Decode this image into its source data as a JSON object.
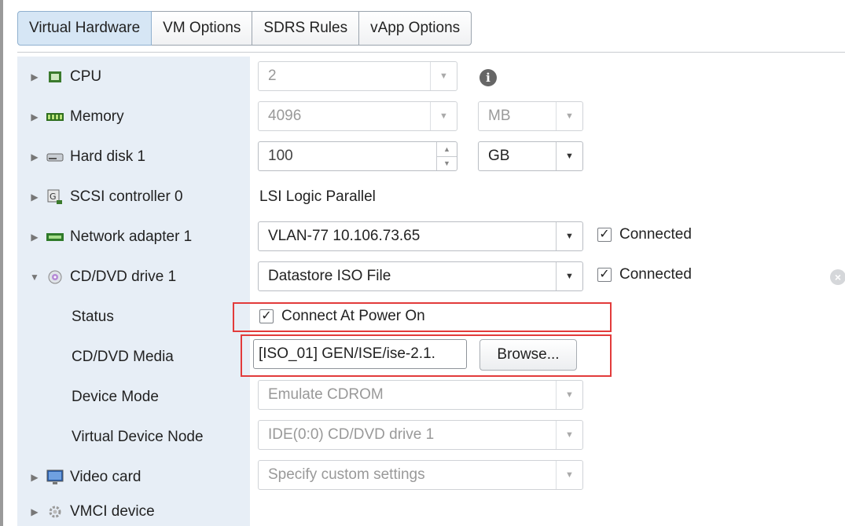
{
  "tabs": [
    {
      "label": "Virtual Hardware",
      "active": true
    },
    {
      "label": "VM Options"
    },
    {
      "label": "SDRS Rules"
    },
    {
      "label": "vApp Options"
    }
  ],
  "hardware": {
    "cpu": {
      "label": "CPU",
      "icon": "cpu-icon",
      "value": "2"
    },
    "memory": {
      "label": "Memory",
      "icon": "memory-icon",
      "value": "4096",
      "unit": "MB"
    },
    "hard_disk": {
      "label": "Hard disk 1",
      "icon": "hard-disk-icon",
      "value": "100",
      "unit": "GB"
    },
    "scsi": {
      "label": "SCSI controller 0",
      "icon": "scsi-controller-icon",
      "value": "LSI Logic Parallel"
    },
    "network": {
      "label": "Network adapter 1",
      "icon": "network-adapter-icon",
      "value": "VLAN-77 10.106.73.65",
      "connected_label": "Connected",
      "connected": true
    },
    "cddvd": {
      "label": "CD/DVD drive 1",
      "icon": "cd-dvd-icon",
      "value": "Datastore ISO File",
      "connected_label": "Connected",
      "connected": true,
      "status": {
        "label": "Status",
        "option_label": "Connect At Power On",
        "checked": true
      },
      "media": {
        "label": "CD/DVD Media",
        "value": "[ISO_01] GEN/ISE/ise-2.1.",
        "browse_label": "Browse..."
      },
      "device_mode": {
        "label": "Device Mode",
        "value": "Emulate CDROM"
      },
      "device_node": {
        "label": "Virtual Device Node",
        "value": "IDE(0:0) CD/DVD drive 1"
      }
    },
    "video": {
      "label": "Video card",
      "icon": "video-card-icon",
      "value": "Specify custom settings"
    },
    "vmci": {
      "label": "VMCI device",
      "icon": "vmci-device-icon"
    }
  },
  "colors": {
    "highlight": "#e23b3b",
    "active_tab": "#d6e6f5",
    "label_panel": "#e7eef6"
  }
}
